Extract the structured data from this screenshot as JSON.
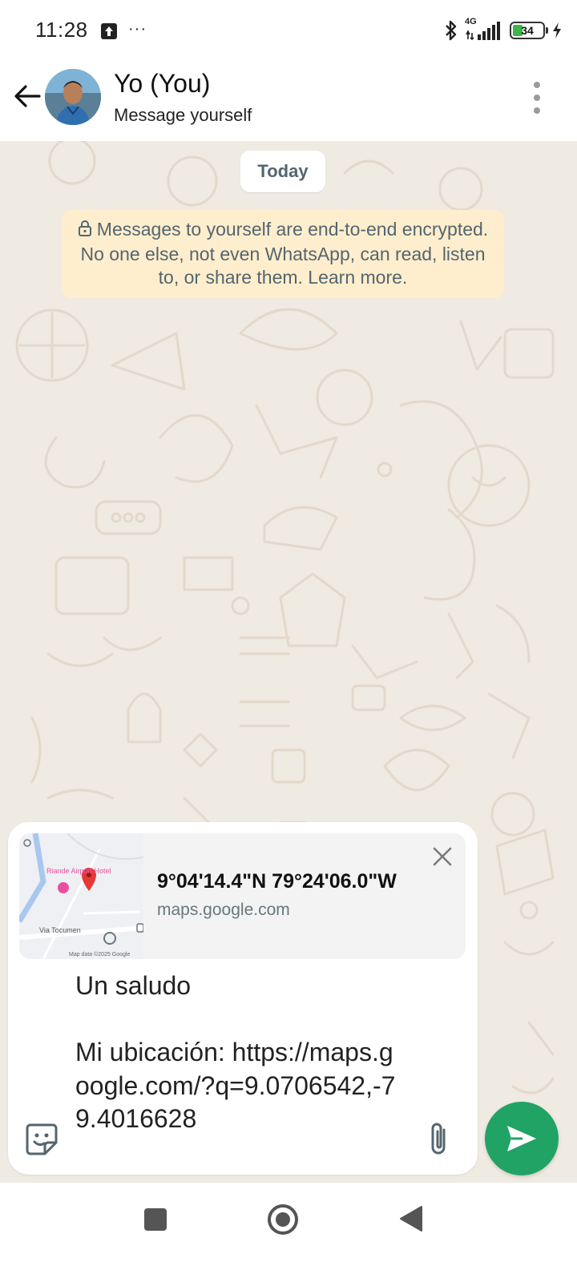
{
  "status_bar": {
    "time": "11:28",
    "more": "···",
    "network": "4G",
    "battery": "34"
  },
  "header": {
    "contact_name": "Yo (You)",
    "contact_status": "Message yourself"
  },
  "chat": {
    "date_label": "Today",
    "encryption_notice": "Messages to yourself are end-to-end encrypted. No one else, not even WhatsApp, can read, listen to, or share them. Learn more."
  },
  "composer": {
    "preview": {
      "title": "9°04'14.4\"N 79°24'06.0\"W",
      "domain": "maps.google.com",
      "map_labels": {
        "hotel": "Riande Airport Hotel",
        "road": "Via Tocumen",
        "attribution": "Map data ©2025 Google"
      }
    },
    "message_text": "Un saludo\n\nMi ubicación: https://maps.google.com/?q=9.0706542,-79.4016628"
  },
  "colors": {
    "accent": "#21a366",
    "chat_bg": "#efeae2",
    "notice_bg": "#ffeecd"
  }
}
